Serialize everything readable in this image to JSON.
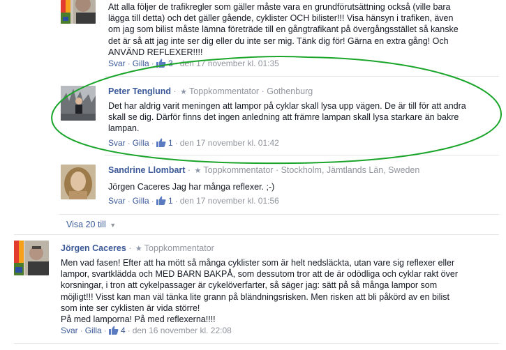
{
  "comments": [
    {
      "text_lines": [
        "Att alla följer de trafikregler som gäller måste vara en grundförutsättning också (ville bara",
        "lägga till detta) och det gäller gående, cyklister OCH bilister!!! Visa hänsyn i trafiken, även",
        "om jag som bilist måste lämna företräde till en gångtrafikant på övergångsstället så kanske",
        "det är så att jag inte ser dig eller du inte ser mig. Tänk dig för! Gärna en extra gång! Och",
        "ANVÄND REFLEXER!!!!"
      ],
      "reply": "Svar",
      "like": "Gilla",
      "likes": "3",
      "time": "den 17 november kl. 01:35"
    },
    {
      "author": "Peter Tenglund",
      "badge": "Toppkommentator",
      "location": "Gothenburg",
      "text_lines": [
        "Det har aldrig varit meningen att lampor på cyklar skall lysa upp vägen. De är till för att andra",
        "skall se dig. Därför finns det ingen anledning att främre lampan skall lysa starkare än bakre",
        "lampan."
      ],
      "reply": "Svar",
      "like": "Gilla",
      "likes": "1",
      "time": "den 17 november kl. 01:42"
    },
    {
      "author": "Sandrine Llombart",
      "badge": "Toppkommentator",
      "location": "Stockholm, Jämtlands Län, Sweden",
      "text_lines": [
        "Jörgen Caceres Jag har många reflexer. ;-)"
      ],
      "reply": "Svar",
      "like": "Gilla",
      "likes": "1",
      "time": "den 17 november kl. 01:56"
    },
    {
      "author": "Jörgen Caceres",
      "badge": "Toppkommentator",
      "text_lines": [
        "Men vad fasen! Efter att ha mött så många cyklister som är helt nedsläckta, utan vare sig reflexer eller",
        "lampor, svartklädda och MED BARN BAKPÅ, som dessutom tror att de är odödliga och cyklar rakt över",
        "korsningar, i tron att cykelpassager är cykelöverfarter, så säger jag: sätt på så många lampor som",
        "möjligt!!! Visst kan man väl tänka lite grann på bländningsrisken. Men risken att bli påkörd av en bilist",
        "som inte ser cyklisten är vida större!",
        "På med lamporna! På med reflexerna!!!!"
      ],
      "reply": "Svar",
      "like": "Gilla",
      "likes": "4",
      "time": "den 16 november kl. 22:08"
    }
  ],
  "see_more": "Visa 20 till",
  "colors": {
    "link": "#3b5998",
    "meta": "#90949c",
    "annotation": "#1aa52a"
  }
}
